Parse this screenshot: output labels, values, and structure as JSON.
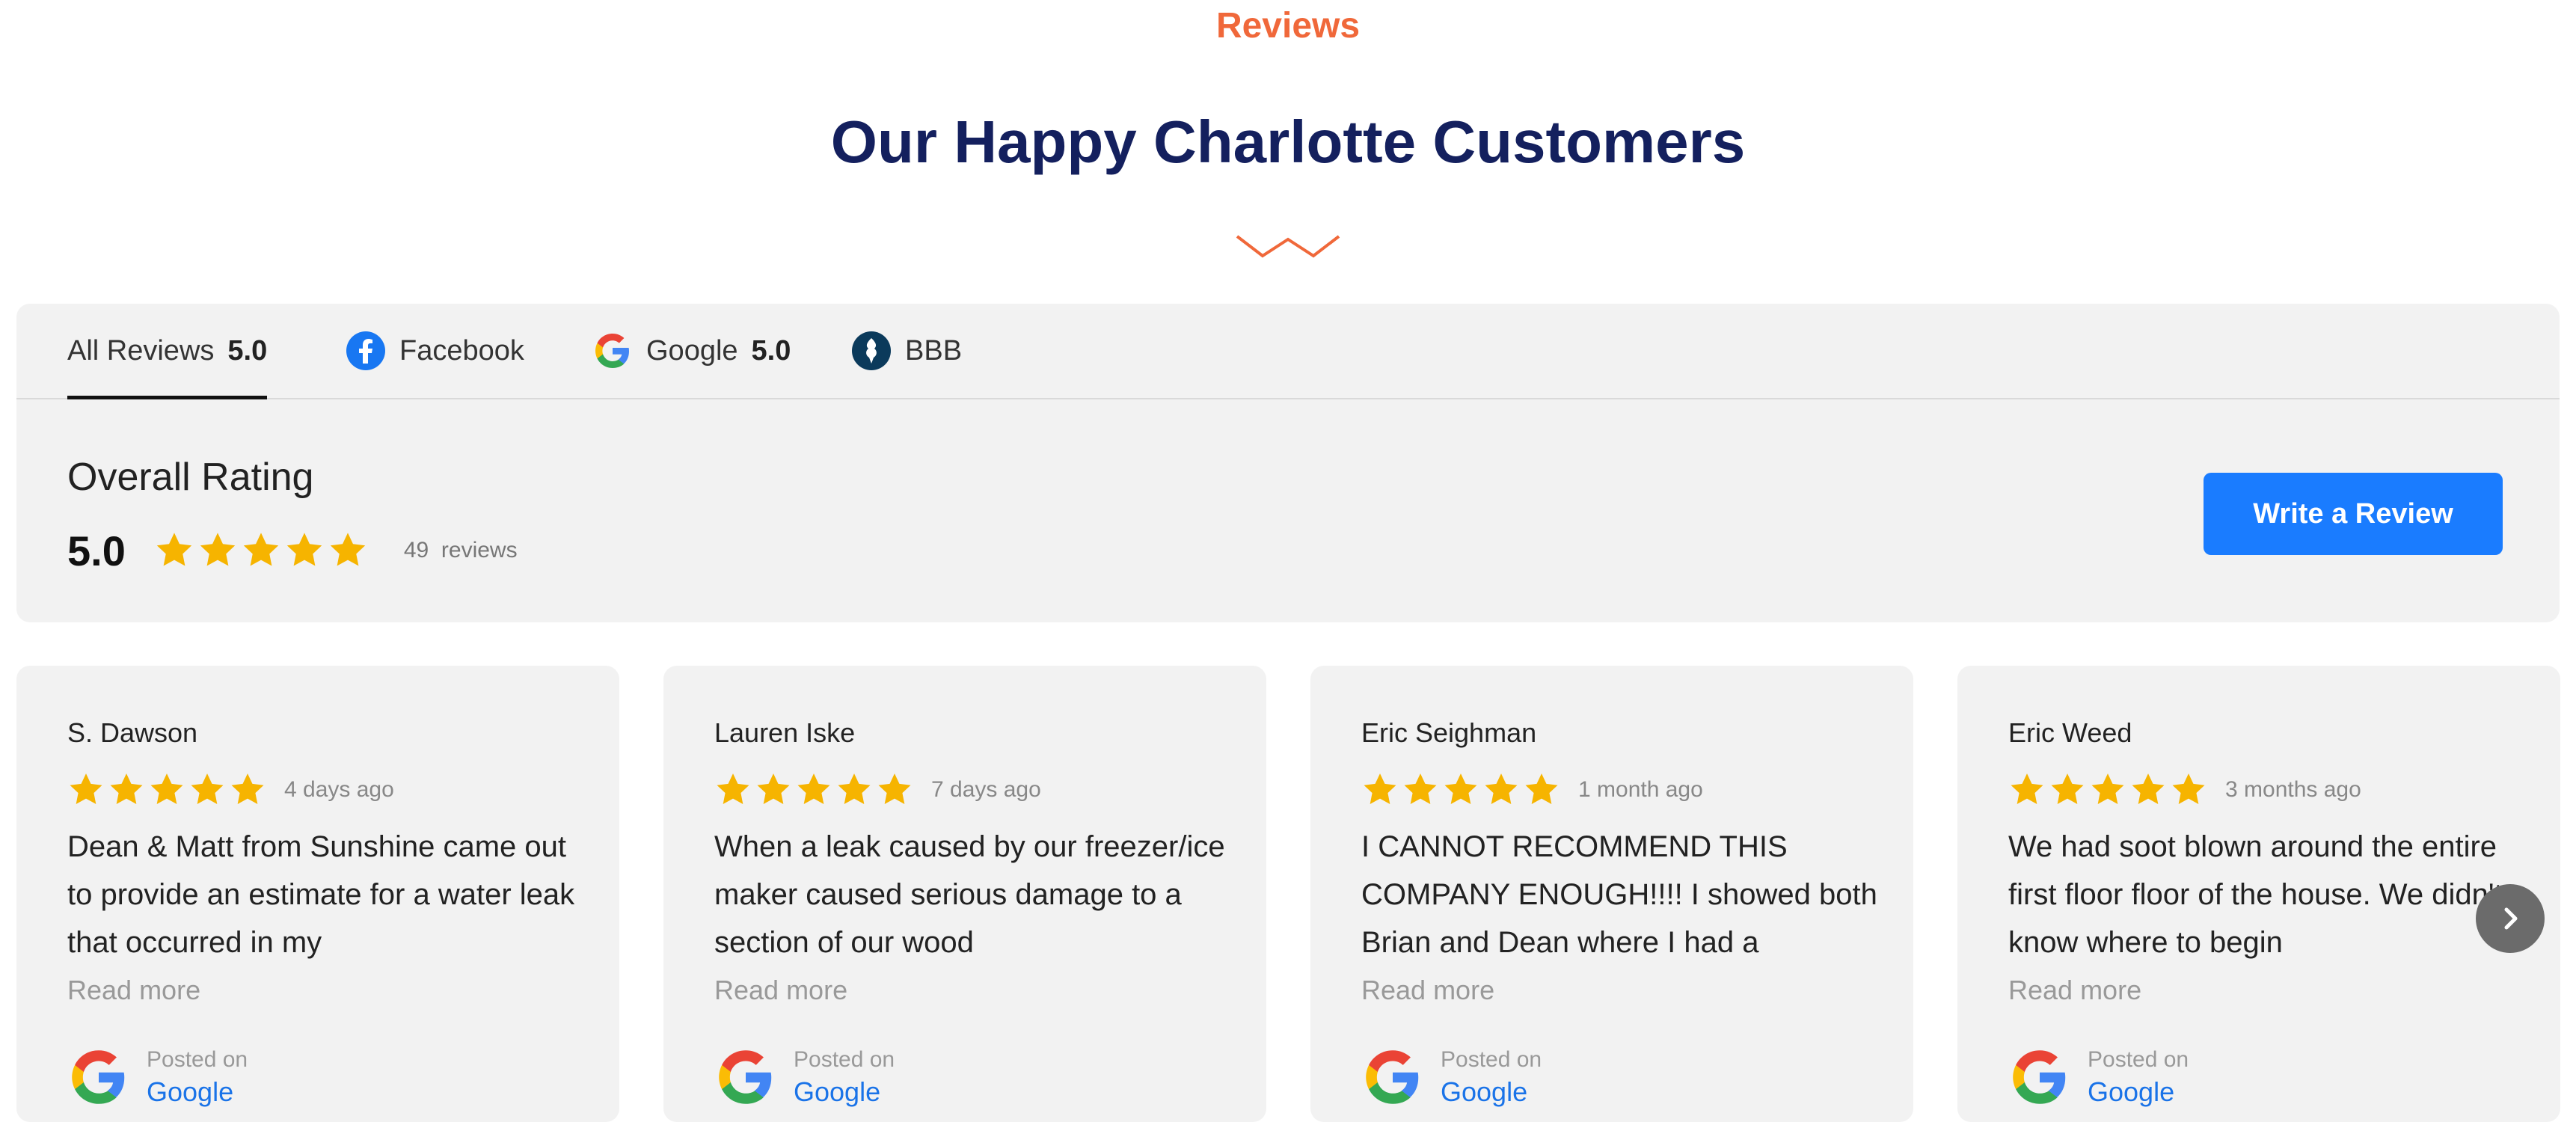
{
  "section": {
    "eyebrow": "Reviews",
    "title": "Our Happy Charlotte Customers"
  },
  "colors": {
    "accent_orange": "#f0683a",
    "title_navy": "#14205e",
    "button_blue": "#1a7cff",
    "star_gold": "#f6b400"
  },
  "tabs": [
    {
      "label": "All Reviews",
      "rating": "5.0",
      "icon": "",
      "active": true
    },
    {
      "label": "Facebook",
      "rating": "",
      "icon": "facebook-icon",
      "active": false
    },
    {
      "label": "Google",
      "rating": "5.0",
      "icon": "google-icon",
      "active": false
    },
    {
      "label": "BBB",
      "rating": "",
      "icon": "bbb-icon",
      "active": false
    }
  ],
  "overall": {
    "label": "Overall Rating",
    "value": "5.0",
    "stars": 5,
    "count": "49",
    "count_label": "reviews"
  },
  "write_review": "Write a Review",
  "reviews": [
    {
      "name": "S. Dawson",
      "stars": 5,
      "date": "4 days ago",
      "text": "Dean & Matt from Sunshine came out to provide an estimate for a water leak that occurred in my",
      "read_more": "Read more",
      "posted_on": "Posted on",
      "site": "Google"
    },
    {
      "name": "Lauren Iske",
      "stars": 5,
      "date": "7 days ago",
      "text": "When a leak caused by our freezer/ice maker caused serious damage to a section of our wood",
      "read_more": "Read more",
      "posted_on": "Posted on",
      "site": "Google"
    },
    {
      "name": "Eric Seighman",
      "stars": 5,
      "date": "1 month ago",
      "text": "I CANNOT RECOMMEND THIS COMPANY ENOUGH!!!! I showed both Brian and Dean where I had a",
      "read_more": "Read more",
      "posted_on": "Posted on",
      "site": "Google"
    },
    {
      "name": "Eric Weed",
      "stars": 5,
      "date": "3 months ago",
      "text": "We had soot blown around the entire first floor floor of the house. We didn't know where to begin",
      "read_more": "Read more",
      "posted_on": "Posted on",
      "site": "Google"
    }
  ]
}
